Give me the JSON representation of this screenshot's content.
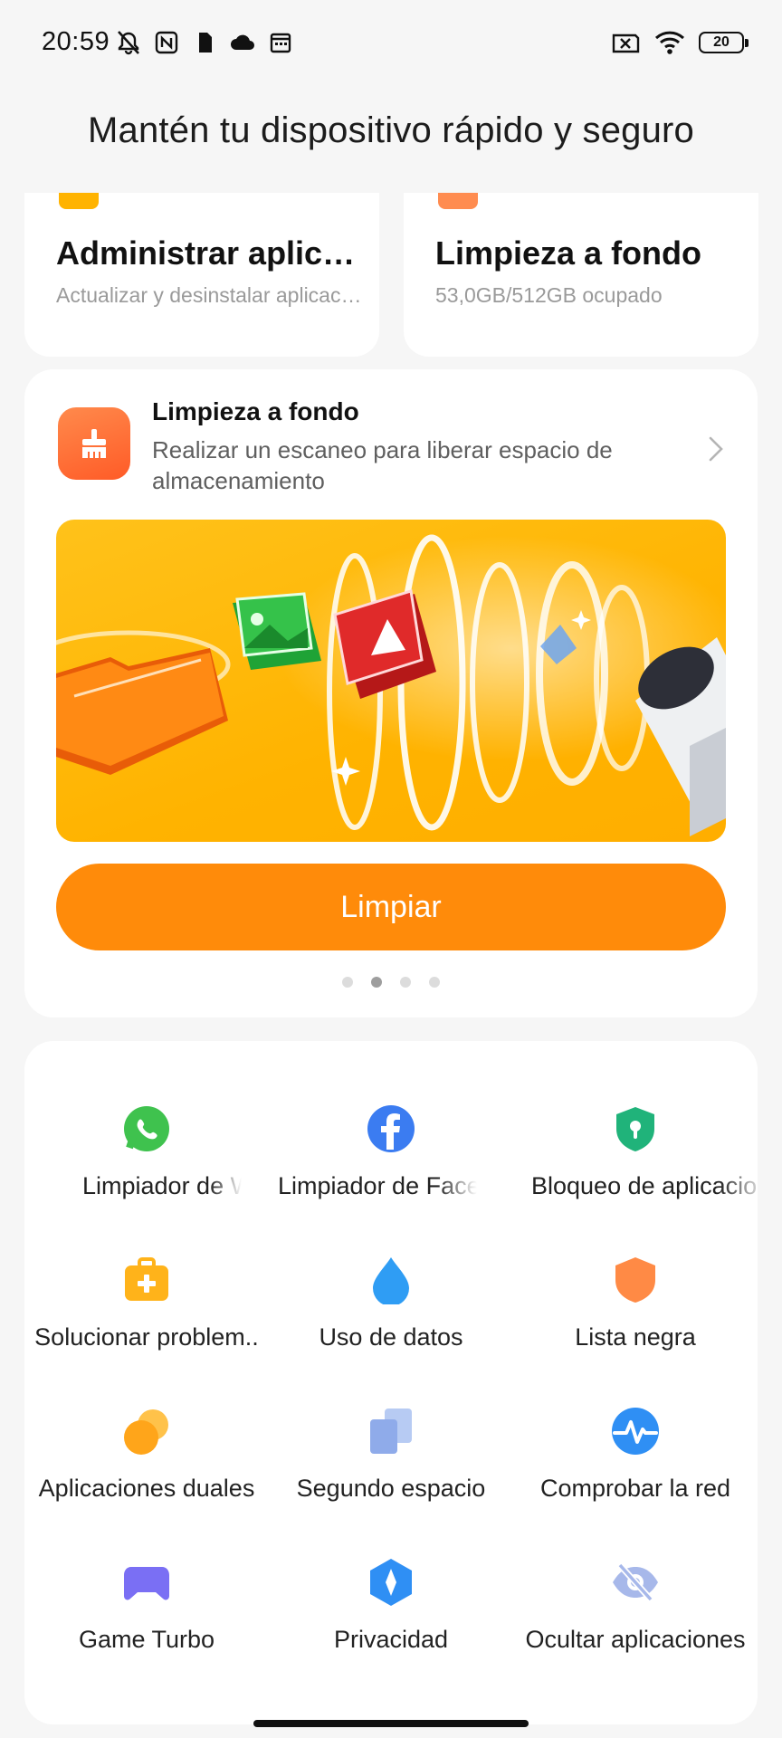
{
  "status_bar": {
    "time": "20:59",
    "battery": "20",
    "left_icons": [
      "mute-icon",
      "nfc-icon",
      "sim-icon",
      "cloud-icon",
      "calendar-icon"
    ],
    "right_icons": [
      "no-sim-icon",
      "wifi-icon",
      "battery-icon"
    ]
  },
  "header": {
    "title": "Mantén tu dispositivo rápido y seguro"
  },
  "top_cards": [
    {
      "title": "Administrar aplicaciones",
      "subtitle": "Actualizar y desinstalar aplicaciones",
      "accent": "#ffb300"
    },
    {
      "title": "Limpieza a fondo",
      "subtitle": "53,0GB/512GB ocupado",
      "accent": "#ff8c50"
    }
  ],
  "promo": {
    "title": "Limpieza a fondo",
    "description": "Realizar un escaneo para liberar espacio de almacenamiento",
    "icon": "broom-icon",
    "button_label": "Limpiar",
    "button_color": "#ff8b0a",
    "pages": 4,
    "active_page": 2
  },
  "tools": [
    {
      "label": "Limpiador de WhatsApp",
      "icon": "whatsapp-icon",
      "color": "#3fc24e"
    },
    {
      "label": "Limpiador de Facebook",
      "icon": "facebook-icon",
      "color": "#3b7cf1"
    },
    {
      "label": "Bloqueo de aplicaciones",
      "icon": "shield-lock-icon",
      "color": "#20b37a"
    },
    {
      "label": "Solucionar problem..",
      "icon": "first-aid-icon",
      "color": "#ffb31a"
    },
    {
      "label": "Uso de datos",
      "icon": "water-drop-icon",
      "color": "#2f9df4"
    },
    {
      "label": "Lista negra",
      "icon": "shield-icon",
      "color": "#ff8a45"
    },
    {
      "label": "Aplicaciones duales",
      "icon": "dual-apps-icon",
      "color": "#ffa51a"
    },
    {
      "label": "Segundo espacio",
      "icon": "second-space-icon",
      "color": "#9db8ef"
    },
    {
      "label": "Comprobar la red",
      "icon": "network-check-icon",
      "color": "#2f8ff4"
    },
    {
      "label": "Game Turbo",
      "icon": "gamepad-icon",
      "color": "#7a6ff4"
    },
    {
      "label": "Privacidad",
      "icon": "privacy-icon",
      "color": "#2f8ff4"
    },
    {
      "label": "Ocultar aplicaciones",
      "icon": "eye-off-icon",
      "color": "#a7b8ea"
    }
  ]
}
